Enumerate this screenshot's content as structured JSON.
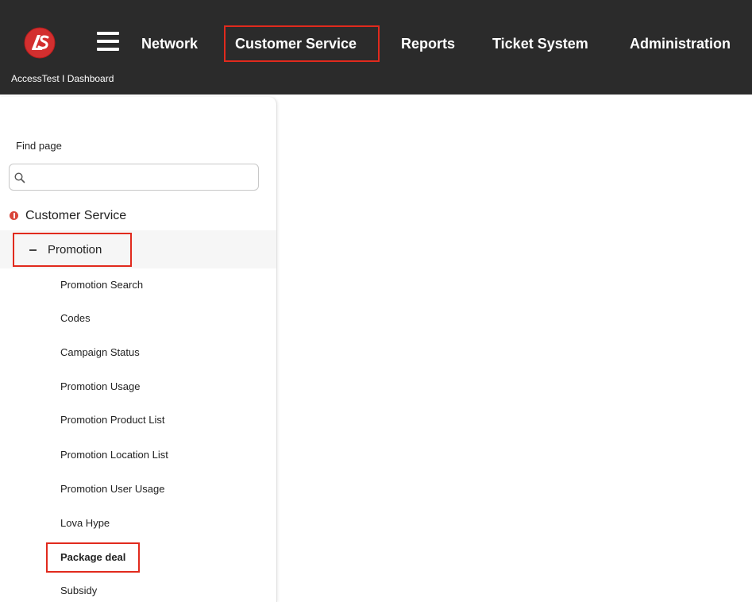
{
  "header": {
    "breadcrumb": "AccessTest I Dashboard",
    "logo_icon": "ls-logo-icon",
    "menu_icon": "hamburger-menu-icon",
    "nav": [
      {
        "label": "Network"
      },
      {
        "label": "Customer Service",
        "highlighted": true
      },
      {
        "label": "Reports"
      },
      {
        "label": "Ticket System"
      },
      {
        "label": "Administration"
      }
    ]
  },
  "sidebar": {
    "find_label": "Find page",
    "search": {
      "value": "",
      "placeholder": ""
    },
    "section": {
      "label": "Customer Service",
      "icon": "info-dot-icon"
    },
    "group": {
      "label": "Promotion",
      "expanded": true
    },
    "items": [
      {
        "label": "Promotion Search"
      },
      {
        "label": "Codes"
      },
      {
        "label": "Campaign Status"
      },
      {
        "label": "Promotion Usage"
      },
      {
        "label": "Promotion Product List"
      },
      {
        "label": "Promotion Location List"
      },
      {
        "label": "Promotion User Usage"
      },
      {
        "label": "Lova Hype"
      },
      {
        "label": "Package deal",
        "highlighted": true
      },
      {
        "label": "Subsidy"
      }
    ]
  },
  "colors": {
    "topbar": "#2b2b2b",
    "highlight": "#e12a1d",
    "logo": "#d32f2f"
  }
}
